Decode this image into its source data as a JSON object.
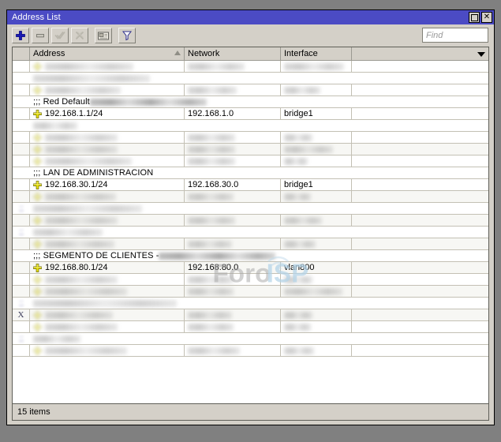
{
  "window": {
    "title": "Address List",
    "maximize_label": "Maximize",
    "close_label": "Close"
  },
  "toolbar": {
    "buttons": [
      {
        "name": "add-button",
        "icon": "plus-icon",
        "enabled": true
      },
      {
        "name": "remove-button",
        "icon": "minus-icon",
        "enabled": true
      },
      {
        "name": "enable-button",
        "icon": "check-icon",
        "enabled": false
      },
      {
        "name": "disable-button",
        "icon": "cross-icon",
        "enabled": false
      },
      {
        "name": "comment-button",
        "icon": "comment-icon",
        "enabled": true
      },
      {
        "name": "filter-button",
        "icon": "funnel-icon",
        "enabled": true
      }
    ],
    "find_placeholder": "Find"
  },
  "table": {
    "columns": [
      {
        "key": "flag",
        "label": ""
      },
      {
        "key": "address",
        "label": "Address",
        "sort": "asc"
      },
      {
        "key": "network",
        "label": "Network"
      },
      {
        "key": "interface",
        "label": "Interface"
      },
      {
        "key": "extra",
        "label": ""
      }
    ],
    "rows": [
      {
        "type": "data",
        "flag": "",
        "address": "",
        "network": "",
        "interface": "",
        "redacted": true,
        "addr_w": 112,
        "net_w": 72,
        "if_w": 76
      },
      {
        "type": "comment",
        "flag": "",
        "comment": "",
        "redacted": true,
        "cmt_w": 148
      },
      {
        "type": "data",
        "flag": "",
        "address": "",
        "network": "",
        "interface": "",
        "redacted": true,
        "addr_w": 96,
        "net_w": 62,
        "if_w": 46
      },
      {
        "type": "comment",
        "flag": "",
        "comment": ";;; Red Default",
        "redacted_suffix": true,
        "cmt_w": 148
      },
      {
        "type": "data",
        "flag": "",
        "address": "192.168.1.1/24",
        "network": "192.168.1.0",
        "interface": "bridge1",
        "redacted": false
      },
      {
        "type": "comment",
        "flag": "",
        "comment": "",
        "redacted": true,
        "cmt_w": 56
      },
      {
        "type": "data",
        "flag": "",
        "address": "",
        "network": "",
        "interface": "",
        "redacted": true,
        "addr_w": 92,
        "net_w": 60,
        "if_w": 36
      },
      {
        "type": "data",
        "flag": "",
        "address": "",
        "network": "",
        "interface": "",
        "redacted": true,
        "addr_w": 92,
        "net_w": 60,
        "if_w": 62
      },
      {
        "type": "data",
        "flag": "",
        "address": "",
        "network": "",
        "interface": "",
        "redacted": true,
        "addr_w": 110,
        "net_w": 60,
        "if_w": 30
      },
      {
        "type": "comment",
        "flag": "",
        "comment": ";;; LAN DE ADMINISTRACION",
        "redacted_suffix": false
      },
      {
        "type": "data",
        "flag": "",
        "address": "192.168.30.1/24",
        "network": "192.168.30.0",
        "interface": "bridge1",
        "redacted": false
      },
      {
        "type": "data",
        "flag": "",
        "address": "",
        "network": "",
        "interface": "",
        "redacted": true,
        "addr_w": 90,
        "net_w": 58,
        "if_w": 34
      },
      {
        "type": "comment",
        "flag": ";;",
        "comment": "",
        "redacted": true,
        "cmt_w": 138
      },
      {
        "type": "data",
        "flag": "",
        "address": "",
        "network": "",
        "interface": "",
        "redacted": true,
        "addr_w": 92,
        "net_w": 60,
        "if_w": 48
      },
      {
        "type": "comment",
        "flag": ";;",
        "comment": "",
        "redacted": true,
        "cmt_w": 88
      },
      {
        "type": "data",
        "flag": "",
        "address": "",
        "network": "",
        "interface": "",
        "redacted": true,
        "addr_w": 88,
        "net_w": 56,
        "if_w": 40
      },
      {
        "type": "comment",
        "flag": "",
        "comment": ";;; SEGMENTO DE CLIENTES -",
        "redacted_suffix": true,
        "cmt_w": 148
      },
      {
        "type": "data",
        "flag": "",
        "address": "192.168.80.1/24",
        "network": "192.168.80.0",
        "interface": "vlan800",
        "redacted": false
      },
      {
        "type": "data",
        "flag": "",
        "address": "",
        "network": "",
        "interface": "",
        "redacted": true,
        "addr_w": 92,
        "net_w": 58,
        "if_w": 36
      },
      {
        "type": "data",
        "flag": "",
        "address": "",
        "network": "",
        "interface": "",
        "redacted": true,
        "addr_w": 104,
        "net_w": 58,
        "if_w": 74
      },
      {
        "type": "comment",
        "flag": ";;",
        "comment": "",
        "redacted": true,
        "cmt_w": 182
      },
      {
        "type": "data",
        "flag": "X",
        "address": "",
        "network": "",
        "interface": "",
        "redacted": true,
        "addr_w": 86,
        "net_w": 56,
        "if_w": 36
      },
      {
        "type": "data",
        "flag": "",
        "address": "",
        "network": "",
        "interface": "",
        "redacted": true,
        "addr_w": 92,
        "net_w": 58,
        "if_w": 34
      },
      {
        "type": "comment",
        "flag": ";;",
        "comment": "",
        "redacted": true,
        "cmt_w": 60
      },
      {
        "type": "data",
        "flag": "",
        "address": "",
        "network": "",
        "interface": "",
        "redacted": true,
        "addr_w": 104,
        "net_w": 66,
        "if_w": 38
      }
    ]
  },
  "watermark": {
    "text_primary": "Foro",
    "text_secondary": "ISP"
  },
  "statusbar": {
    "items_count": "15 items"
  },
  "colors": {
    "titlebar": "#4b4bc4",
    "chrome": "#d4d0c8",
    "desktop": "#808080",
    "addr_icon": "#e8e000",
    "watermark_grey": "#9a9a9a",
    "watermark_blue": "#b9d6ea"
  }
}
